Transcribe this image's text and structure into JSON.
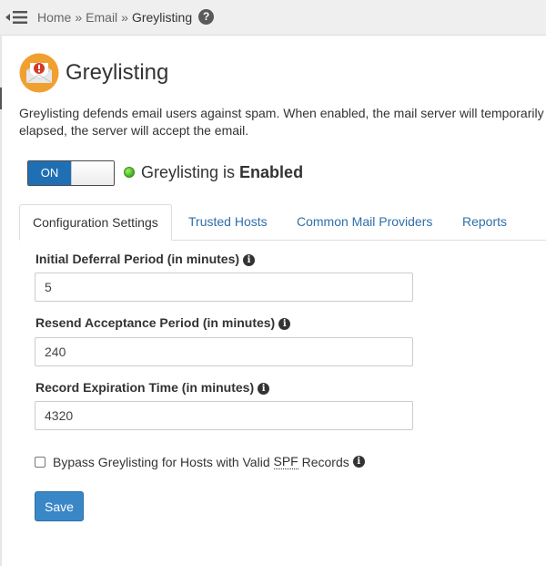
{
  "breadcrumb": {
    "items": [
      "Home",
      "Email"
    ],
    "separator": "»",
    "current": "Greylisting"
  },
  "help_icon_glyph": "?",
  "page": {
    "title": "Greylisting",
    "description_line1": "Greylisting defends email users against spam. When enabled, the mail server will temporarily",
    "description_line2": "elapsed, the server will accept the email."
  },
  "toggle": {
    "label": "ON",
    "state": "on"
  },
  "status": {
    "prefix": "Greylisting is",
    "value": "Enabled",
    "color": "#3fae1d"
  },
  "tabs": [
    {
      "label": "Configuration Settings",
      "active": true
    },
    {
      "label": "Trusted Hosts",
      "active": false
    },
    {
      "label": "Common Mail Providers",
      "active": false
    },
    {
      "label": "Reports",
      "active": false
    }
  ],
  "fields": [
    {
      "label": "Initial Deferral Period (in minutes)",
      "value": "5"
    },
    {
      "label": "Resend Acceptance Period (in minutes)",
      "value": "240"
    },
    {
      "label": "Record Expiration Time (in minutes)",
      "value": "4320"
    }
  ],
  "info_icon_glyph": "i",
  "bypass": {
    "label_prefix": "Bypass Greylisting for Hosts with Valid",
    "label_abbr": "SPF",
    "label_suffix": "Records",
    "checked": false
  },
  "save_label": "Save",
  "colors": {
    "accent": "#1f6fb5",
    "link": "#2f6fa9",
    "save_button": "#3a87c8",
    "icon_orange": "#f0a030",
    "icon_red": "#d23a2a"
  }
}
